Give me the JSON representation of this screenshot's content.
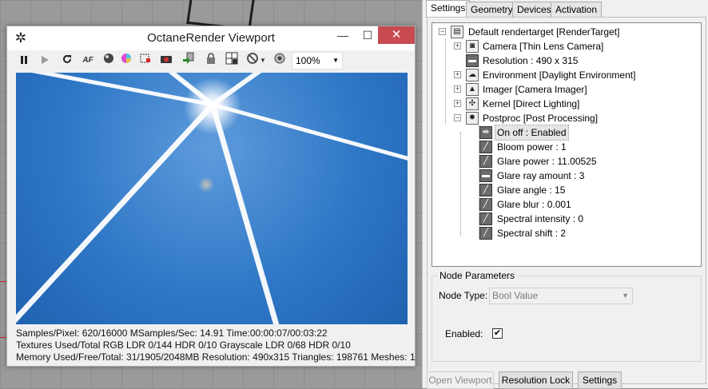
{
  "window": {
    "title": "OctaneRender Viewport",
    "minimize_glyph": "—",
    "maximize_glyph": "☐",
    "close_glyph": "✕"
  },
  "toolbar": {
    "zoom": "100%",
    "icons": [
      "pause-icon",
      "play-icon",
      "restart-icon",
      "af-icon",
      "sphere-icon",
      "color-wheel-icon",
      "region-icon",
      "camera-icon",
      "export-icon",
      "lock-icon",
      "grid-icon",
      "no-entry-icon",
      "dropdown-arrow-icon",
      "settings-sphere-icon"
    ],
    "af_label": "AF"
  },
  "stats": {
    "line1": "Samples/Pixel: 620/16000  MSamples/Sec: 14.91  Time:00:00:07/00:03:22",
    "line2": "Textures Used/Total RGB LDR 0/144  HDR 0/10  Grayscale LDR 0/68  HDR 0/10",
    "line3": "Memory Used/Free/Total: 31/1905/2048MB  Resolution: 490x315  Triangles: 198761  Meshes:  1"
  },
  "tabs": [
    "Settings",
    "Geometry",
    "Devices",
    "Activation"
  ],
  "tree": {
    "root": "Default rendertarget  [RenderTarget]",
    "children": [
      {
        "label": "Camera  [Thin Lens Camera]",
        "icon": "camera-icon",
        "expander": "+"
      },
      {
        "label": "Resolution : 490 x 315",
        "icon": "resolution-icon",
        "expander": ""
      },
      {
        "label": "Environment  [Daylight Environment]",
        "icon": "environment-icon",
        "expander": "+"
      },
      {
        "label": "Imager  [Camera Imager]",
        "icon": "imager-icon",
        "expander": "+"
      },
      {
        "label": "Kernel  [Direct Lighting]",
        "icon": "kernel-icon",
        "expander": "+"
      },
      {
        "label": "Postproc  [Post Processing]",
        "icon": "postproc-icon",
        "expander": "−"
      }
    ],
    "postproc_items": [
      "On off : Enabled",
      "Bloom power : 1",
      "Glare power : 11.00525",
      "Glare ray amount : 3",
      "Glare angle : 15",
      "Glare blur : 0.001",
      "Spectral intensity : 0",
      "Spectral shift : 2"
    ]
  },
  "node_parameters": {
    "title": "Node Parameters",
    "node_type_label": "Node Type:",
    "node_type_value": "Bool Value",
    "enabled_label": "Enabled:",
    "enabled_checked": true,
    "check_glyph": "✔"
  },
  "buttons": {
    "open_viewport": "Open Viewport",
    "resolution_lock": "Resolution Lock",
    "settings": "Settings"
  },
  "colors": {
    "close_button": "#c74b50",
    "sky": "#2f78c6"
  }
}
